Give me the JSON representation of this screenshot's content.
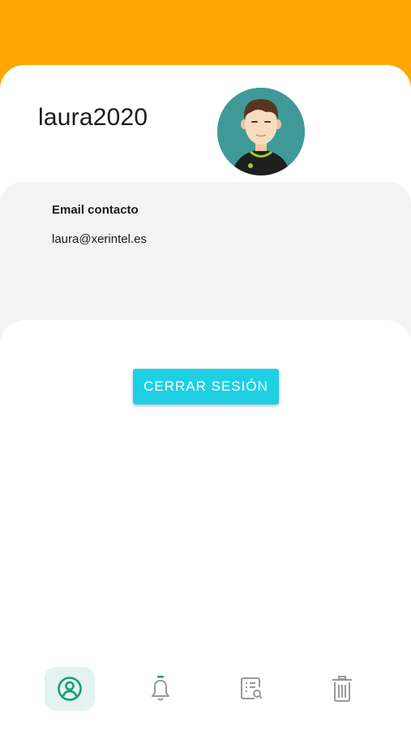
{
  "profile": {
    "username": "laura2020",
    "email_label": "Email contacto",
    "email": "laura@xerintel.es"
  },
  "actions": {
    "logout_label": "CERRAR SESIÓN"
  },
  "nav": {
    "items": [
      {
        "icon": "user-circle-icon",
        "active": true
      },
      {
        "icon": "bell-icon",
        "active": false
      },
      {
        "icon": "document-search-icon",
        "active": false
      },
      {
        "icon": "trash-icon",
        "active": false
      }
    ]
  },
  "colors": {
    "header": "#ffa700",
    "accent_button": "#1fd0e4",
    "nav_active": "#1a9a78",
    "nav_inactive": "#9a9a9a",
    "avatar_background": "#3f9a97"
  }
}
